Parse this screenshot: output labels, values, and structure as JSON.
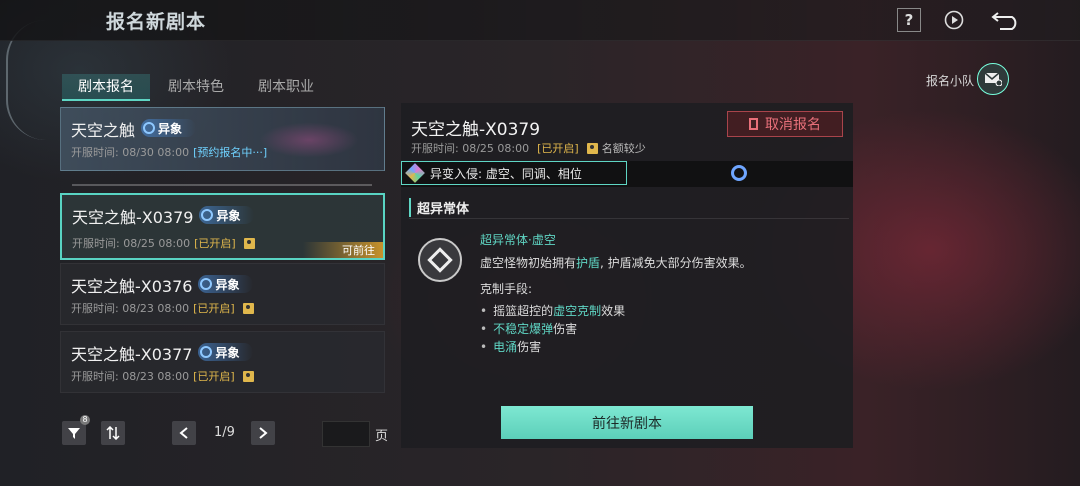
{
  "header": {
    "title": "报名新剧本",
    "help_symbol": "?"
  },
  "party": {
    "label": "报名小队"
  },
  "tabs": [
    {
      "label": "剧本报名",
      "active": true
    },
    {
      "label": "剧本特色",
      "active": false
    },
    {
      "label": "剧本职业",
      "active": false
    }
  ],
  "cards": [
    {
      "name": "天空之触",
      "badge": "异象",
      "open_time": "开服时间: 08/30 08:00",
      "status": "[预约报名中···]"
    },
    {
      "name": "天空之触-X0379",
      "badge": "异象",
      "open_time": "开服时间: 08/25 08:00",
      "status": "[已开启]",
      "tag": "可前往",
      "selected": true
    },
    {
      "name": "天空之触-X0376",
      "badge": "异象",
      "open_time": "开服时间: 08/23 08:00",
      "status": "[已开启]"
    },
    {
      "name": "天空之触-X0377",
      "badge": "异象",
      "open_time": "开服时间: 08/23 08:00",
      "status": "[已开启]"
    }
  ],
  "pager": {
    "filter_count": "8",
    "current": "1/9",
    "unit": "页",
    "input_value": ""
  },
  "detail": {
    "title": "天空之触-X0379",
    "cancel_label": "取消报名",
    "open_time": "开服时间: 08/25 08:00",
    "status": "[已开启]",
    "seats": "名额较少",
    "mutation": "异变入侵: 虚空、同调、相位",
    "section_title": "超异常体",
    "abnormal_name": "超异常体·虚空",
    "desc_pre": "虚空怪物初始拥有",
    "desc_highlight": "护盾",
    "desc_post": ", 护盾减免大部分伤害效果。",
    "counter_title": "克制手段:",
    "counters": [
      {
        "pre": "摇篮超控的",
        "hl": "虚空克制",
        "post": "效果"
      },
      {
        "pre": "",
        "hl": "不稳定爆弹",
        "post": "伤害"
      },
      {
        "pre": "",
        "hl": "电涌",
        "post": "伤害"
      }
    ],
    "go_label": "前往新剧本"
  },
  "colors": {
    "accent": "#5fd6c4",
    "gold": "#e0b74c",
    "cancel": "#e8707a"
  }
}
